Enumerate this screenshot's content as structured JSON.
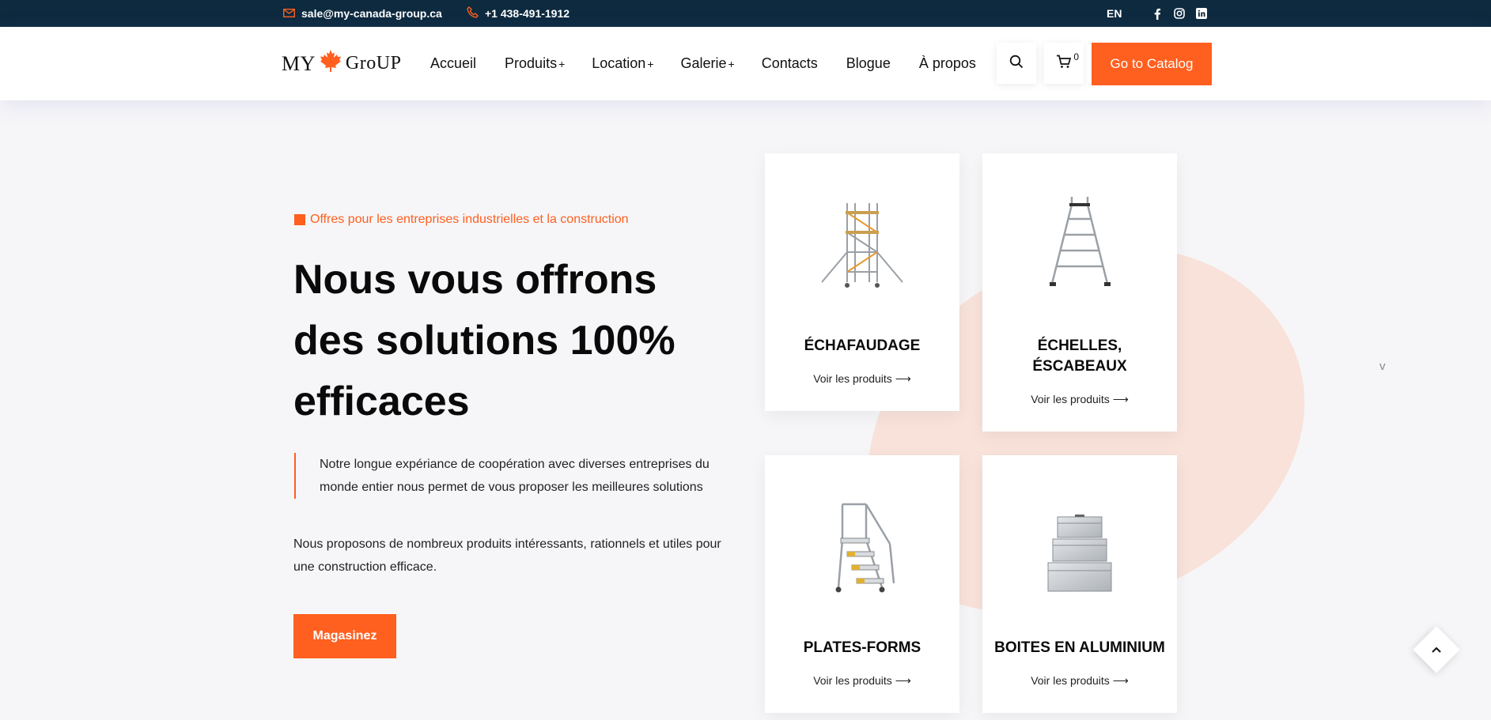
{
  "topbar": {
    "email": "sale@my-canada-group.ca",
    "phone": "+1 438-491-1912",
    "lang": "EN"
  },
  "header": {
    "logo_left": "MY",
    "logo_right": "GroUP",
    "nav": [
      {
        "label": "Accueil",
        "plus": ""
      },
      {
        "label": "Produits",
        "plus": "+"
      },
      {
        "label": "Location",
        "plus": "+"
      },
      {
        "label": "Galerie",
        "plus": "+"
      },
      {
        "label": "Contacts",
        "plus": ""
      },
      {
        "label": "Blogue",
        "plus": ""
      },
      {
        "label": "À propos",
        "plus": ""
      }
    ],
    "cart_count": "0",
    "catalog_label": "Go to Catalog"
  },
  "hero": {
    "tagline": "Offres pour les entreprises industrielles et la construction",
    "title": "Nous vous offrons des solutions 100% efficaces",
    "quote": "Notre longue expériance de coopération avec diverses entreprises du monde entier nous permet de vous proposer les meilleures solutions",
    "description": "Nous proposons de nombreux produits intéressants, rationnels et utiles pour une construction efficace.",
    "shop_label": "Magasinez"
  },
  "cards": [
    {
      "title": "ÉCHAFAUDAGE",
      "link": "Voir les produits",
      "icon": "scaffold-icon"
    },
    {
      "title": "ÉCHELLES, ÉSCABEAUX",
      "link": "Voir les produits",
      "icon": "ladder-icon"
    },
    {
      "title": "PLATES-FORMS",
      "link": "Voir les produits",
      "icon": "platform-icon"
    },
    {
      "title": "BOITES EN ALUMINIUM",
      "link": "Voir les produits",
      "icon": "aluminium-box-icon"
    }
  ],
  "side_chevron": "v",
  "colors": {
    "accent": "#ff5f1f",
    "topbar": "#0d2a3f",
    "blob": "#f8e2da"
  }
}
